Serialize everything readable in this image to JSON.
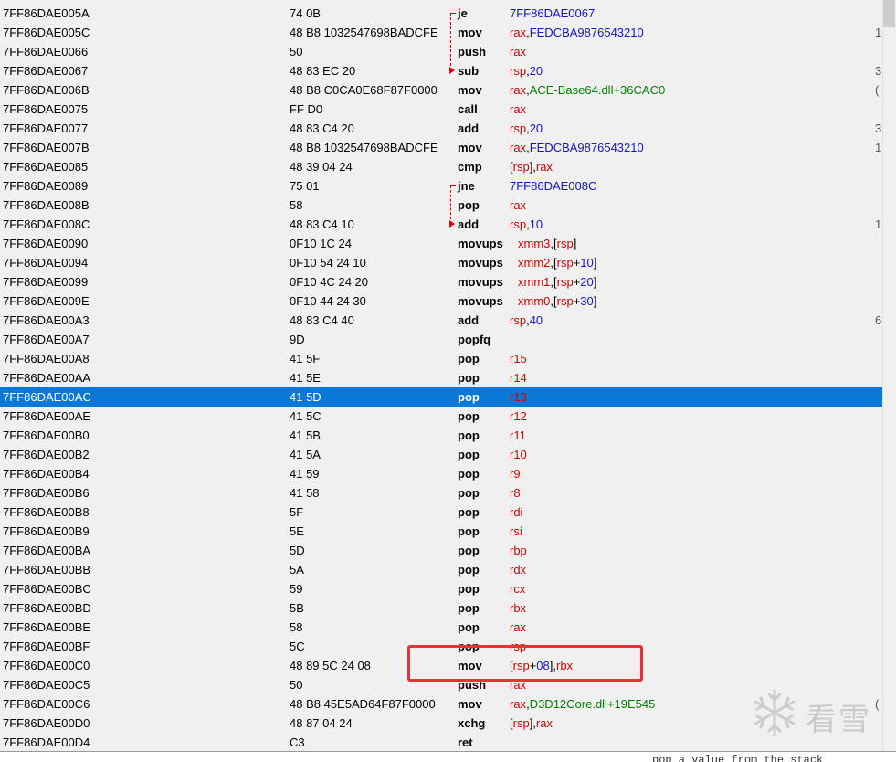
{
  "rows": [
    {
      "addr": "7FF86DAE005A",
      "bytes": "74 0B",
      "mn": "je",
      "op": [
        {
          "t": "7FF86DAE0067",
          "c": "num"
        }
      ],
      "cm": ""
    },
    {
      "addr": "7FF86DAE005C",
      "bytes": "48 B8 1032547698BADCFE",
      "mn": "mov",
      "op": [
        {
          "t": "rax",
          "c": "reg"
        },
        {
          "t": ",",
          "c": ""
        },
        {
          "t": "FEDCBA9876543210",
          "c": "num"
        }
      ],
      "cm": "1"
    },
    {
      "addr": "7FF86DAE0066",
      "bytes": "50",
      "mn": "push",
      "op": [
        {
          "t": "rax",
          "c": "reg"
        }
      ],
      "cm": ""
    },
    {
      "addr": "7FF86DAE0067",
      "bytes": "48 83 EC 20",
      "mn": "sub",
      "op": [
        {
          "t": "rsp",
          "c": "reg"
        },
        {
          "t": ",",
          "c": ""
        },
        {
          "t": "20",
          "c": "num"
        }
      ],
      "cm": "3"
    },
    {
      "addr": "7FF86DAE006B",
      "bytes": "48 B8 C0CA0E68F87F0000",
      "mn": "mov",
      "op": [
        {
          "t": "rax",
          "c": "reg"
        },
        {
          "t": ",",
          "c": ""
        },
        {
          "t": "ACE-Base64.dll+36CAC0",
          "c": "sym"
        }
      ],
      "cm": "("
    },
    {
      "addr": "7FF86DAE0075",
      "bytes": "FF D0",
      "mn": "call",
      "op": [
        {
          "t": "rax",
          "c": "reg"
        }
      ],
      "cm": ""
    },
    {
      "addr": "7FF86DAE0077",
      "bytes": "48 83 C4 20",
      "mn": "add",
      "op": [
        {
          "t": "rsp",
          "c": "reg"
        },
        {
          "t": ",",
          "c": ""
        },
        {
          "t": "20",
          "c": "num"
        }
      ],
      "cm": "3"
    },
    {
      "addr": "7FF86DAE007B",
      "bytes": "48 B8 1032547698BADCFE",
      "mn": "mov",
      "op": [
        {
          "t": "rax",
          "c": "reg"
        },
        {
          "t": ",",
          "c": ""
        },
        {
          "t": "FEDCBA9876543210",
          "c": "num"
        }
      ],
      "cm": "1"
    },
    {
      "addr": "7FF86DAE0085",
      "bytes": "48 39 04 24",
      "mn": "cmp",
      "op": [
        {
          "t": "[",
          "c": ""
        },
        {
          "t": "rsp",
          "c": "reg"
        },
        {
          "t": "],",
          "c": ""
        },
        {
          "t": "rax",
          "c": "reg"
        }
      ],
      "cm": ""
    },
    {
      "addr": "7FF86DAE0089",
      "bytes": "75 01",
      "mn": "jne",
      "op": [
        {
          "t": "7FF86DAE008C",
          "c": "num"
        }
      ],
      "cm": ""
    },
    {
      "addr": "7FF86DAE008B",
      "bytes": "58",
      "mn": "pop",
      "op": [
        {
          "t": "rax",
          "c": "reg"
        }
      ],
      "cm": ""
    },
    {
      "addr": "7FF86DAE008C",
      "bytes": "48 83 C4 10",
      "mn": "add",
      "op": [
        {
          "t": "rsp",
          "c": "reg"
        },
        {
          "t": ",",
          "c": ""
        },
        {
          "t": "10",
          "c": "num"
        }
      ],
      "cm": "1"
    },
    {
      "addr": "7FF86DAE0090",
      "bytes": "0F10 1C 24",
      "mn": "movups",
      "w": true,
      "op": [
        {
          "t": "xmm3",
          "c": "reg"
        },
        {
          "t": ",[",
          "c": ""
        },
        {
          "t": "rsp",
          "c": "reg"
        },
        {
          "t": "]",
          "c": ""
        }
      ],
      "cm": ""
    },
    {
      "addr": "7FF86DAE0094",
      "bytes": "0F10 54 24 10",
      "mn": "movups",
      "w": true,
      "op": [
        {
          "t": "xmm2",
          "c": "reg"
        },
        {
          "t": ",[",
          "c": ""
        },
        {
          "t": "rsp",
          "c": "reg"
        },
        {
          "t": "+",
          "c": ""
        },
        {
          "t": "10",
          "c": "num"
        },
        {
          "t": "]",
          "c": ""
        }
      ],
      "cm": ""
    },
    {
      "addr": "7FF86DAE0099",
      "bytes": "0F10 4C 24 20",
      "mn": "movups",
      "w": true,
      "op": [
        {
          "t": "xmm1",
          "c": "reg"
        },
        {
          "t": ",[",
          "c": ""
        },
        {
          "t": "rsp",
          "c": "reg"
        },
        {
          "t": "+",
          "c": ""
        },
        {
          "t": "20",
          "c": "num"
        },
        {
          "t": "]",
          "c": ""
        }
      ],
      "cm": ""
    },
    {
      "addr": "7FF86DAE009E",
      "bytes": "0F10 44 24 30",
      "mn": "movups",
      "w": true,
      "op": [
        {
          "t": "xmm0",
          "c": "reg"
        },
        {
          "t": ",[",
          "c": ""
        },
        {
          "t": "rsp",
          "c": "reg"
        },
        {
          "t": "+",
          "c": ""
        },
        {
          "t": "30",
          "c": "num"
        },
        {
          "t": "]",
          "c": ""
        }
      ],
      "cm": ""
    },
    {
      "addr": "7FF86DAE00A3",
      "bytes": "48 83 C4 40",
      "mn": "add",
      "op": [
        {
          "t": "rsp",
          "c": "reg"
        },
        {
          "t": ",",
          "c": ""
        },
        {
          "t": "40",
          "c": "num"
        }
      ],
      "cm": "6"
    },
    {
      "addr": "7FF86DAE00A7",
      "bytes": "9D",
      "mn": "popfq",
      "op": [],
      "cm": ""
    },
    {
      "addr": "7FF86DAE00A8",
      "bytes": "41 5F",
      "mn": "pop",
      "op": [
        {
          "t": "r15",
          "c": "reg"
        }
      ],
      "cm": ""
    },
    {
      "addr": "7FF86DAE00AA",
      "bytes": "41 5E",
      "mn": "pop",
      "op": [
        {
          "t": "r14",
          "c": "reg"
        }
      ],
      "cm": ""
    },
    {
      "addr": "7FF86DAE00AC",
      "bytes": "41 5D",
      "mn": "pop",
      "op": [
        {
          "t": "r13",
          "c": "reg"
        }
      ],
      "cm": "",
      "selected": true
    },
    {
      "addr": "7FF86DAE00AE",
      "bytes": "41 5C",
      "mn": "pop",
      "op": [
        {
          "t": "r12",
          "c": "reg"
        }
      ],
      "cm": ""
    },
    {
      "addr": "7FF86DAE00B0",
      "bytes": "41 5B",
      "mn": "pop",
      "op": [
        {
          "t": "r11",
          "c": "reg"
        }
      ],
      "cm": ""
    },
    {
      "addr": "7FF86DAE00B2",
      "bytes": "41 5A",
      "mn": "pop",
      "op": [
        {
          "t": "r10",
          "c": "reg"
        }
      ],
      "cm": ""
    },
    {
      "addr": "7FF86DAE00B4",
      "bytes": "41 59",
      "mn": "pop",
      "op": [
        {
          "t": "r9",
          "c": "reg"
        }
      ],
      "cm": ""
    },
    {
      "addr": "7FF86DAE00B6",
      "bytes": "41 58",
      "mn": "pop",
      "op": [
        {
          "t": "r8",
          "c": "reg"
        }
      ],
      "cm": ""
    },
    {
      "addr": "7FF86DAE00B8",
      "bytes": "5F",
      "mn": "pop",
      "op": [
        {
          "t": "rdi",
          "c": "reg"
        }
      ],
      "cm": ""
    },
    {
      "addr": "7FF86DAE00B9",
      "bytes": "5E",
      "mn": "pop",
      "op": [
        {
          "t": "rsi",
          "c": "reg"
        }
      ],
      "cm": ""
    },
    {
      "addr": "7FF86DAE00BA",
      "bytes": "5D",
      "mn": "pop",
      "op": [
        {
          "t": "rbp",
          "c": "reg"
        }
      ],
      "cm": ""
    },
    {
      "addr": "7FF86DAE00BB",
      "bytes": "5A",
      "mn": "pop",
      "op": [
        {
          "t": "rdx",
          "c": "reg"
        }
      ],
      "cm": ""
    },
    {
      "addr": "7FF86DAE00BC",
      "bytes": "59",
      "mn": "pop",
      "op": [
        {
          "t": "rcx",
          "c": "reg"
        }
      ],
      "cm": ""
    },
    {
      "addr": "7FF86DAE00BD",
      "bytes": "5B",
      "mn": "pop",
      "op": [
        {
          "t": "rbx",
          "c": "reg"
        }
      ],
      "cm": ""
    },
    {
      "addr": "7FF86DAE00BE",
      "bytes": "58",
      "mn": "pop",
      "op": [
        {
          "t": "rax",
          "c": "reg"
        }
      ],
      "cm": ""
    },
    {
      "addr": "7FF86DAE00BF",
      "bytes": "5C",
      "mn": "pop",
      "op": [
        {
          "t": "rsp",
          "c": "reg"
        }
      ],
      "cm": ""
    },
    {
      "addr": "7FF86DAE00C0",
      "bytes": "48 89 5C 24 08",
      "mn": "mov",
      "op": [
        {
          "t": "[",
          "c": ""
        },
        {
          "t": "rsp",
          "c": "reg"
        },
        {
          "t": "+",
          "c": ""
        },
        {
          "t": "08",
          "c": "num"
        },
        {
          "t": "],",
          "c": ""
        },
        {
          "t": "rbx",
          "c": "reg"
        }
      ],
      "cm": ""
    },
    {
      "addr": "7FF86DAE00C5",
      "bytes": "50",
      "mn": "push",
      "op": [
        {
          "t": "rax",
          "c": "reg"
        }
      ],
      "cm": ""
    },
    {
      "addr": "7FF86DAE00C6",
      "bytes": "48 B8 45E5AD64F87F0000",
      "mn": "mov",
      "op": [
        {
          "t": "rax",
          "c": "reg"
        },
        {
          "t": ",",
          "c": ""
        },
        {
          "t": "D3D12Core.dll+19E545",
          "c": "sym"
        }
      ],
      "cm": "("
    },
    {
      "addr": "7FF86DAE00D0",
      "bytes": "48 87 04 24",
      "mn": "xchg",
      "op": [
        {
          "t": "[",
          "c": ""
        },
        {
          "t": "rsp",
          "c": "reg"
        },
        {
          "t": "],",
          "c": ""
        },
        {
          "t": "rax",
          "c": "reg"
        }
      ],
      "cm": ""
    },
    {
      "addr": "7FF86DAE00D4",
      "bytes": "C3",
      "mn": "ret",
      "op": [],
      "cm": ""
    }
  ],
  "info_bar": {
    "text": "pop a value from the stack"
  },
  "watermark": {
    "text": "看雪"
  },
  "colors": {
    "register": "#d40000",
    "number": "#1515c8",
    "symbol": "#008000",
    "selection": "#0a78d7",
    "highlight_box": "#e53333",
    "jump_arrow": "#e00000"
  }
}
